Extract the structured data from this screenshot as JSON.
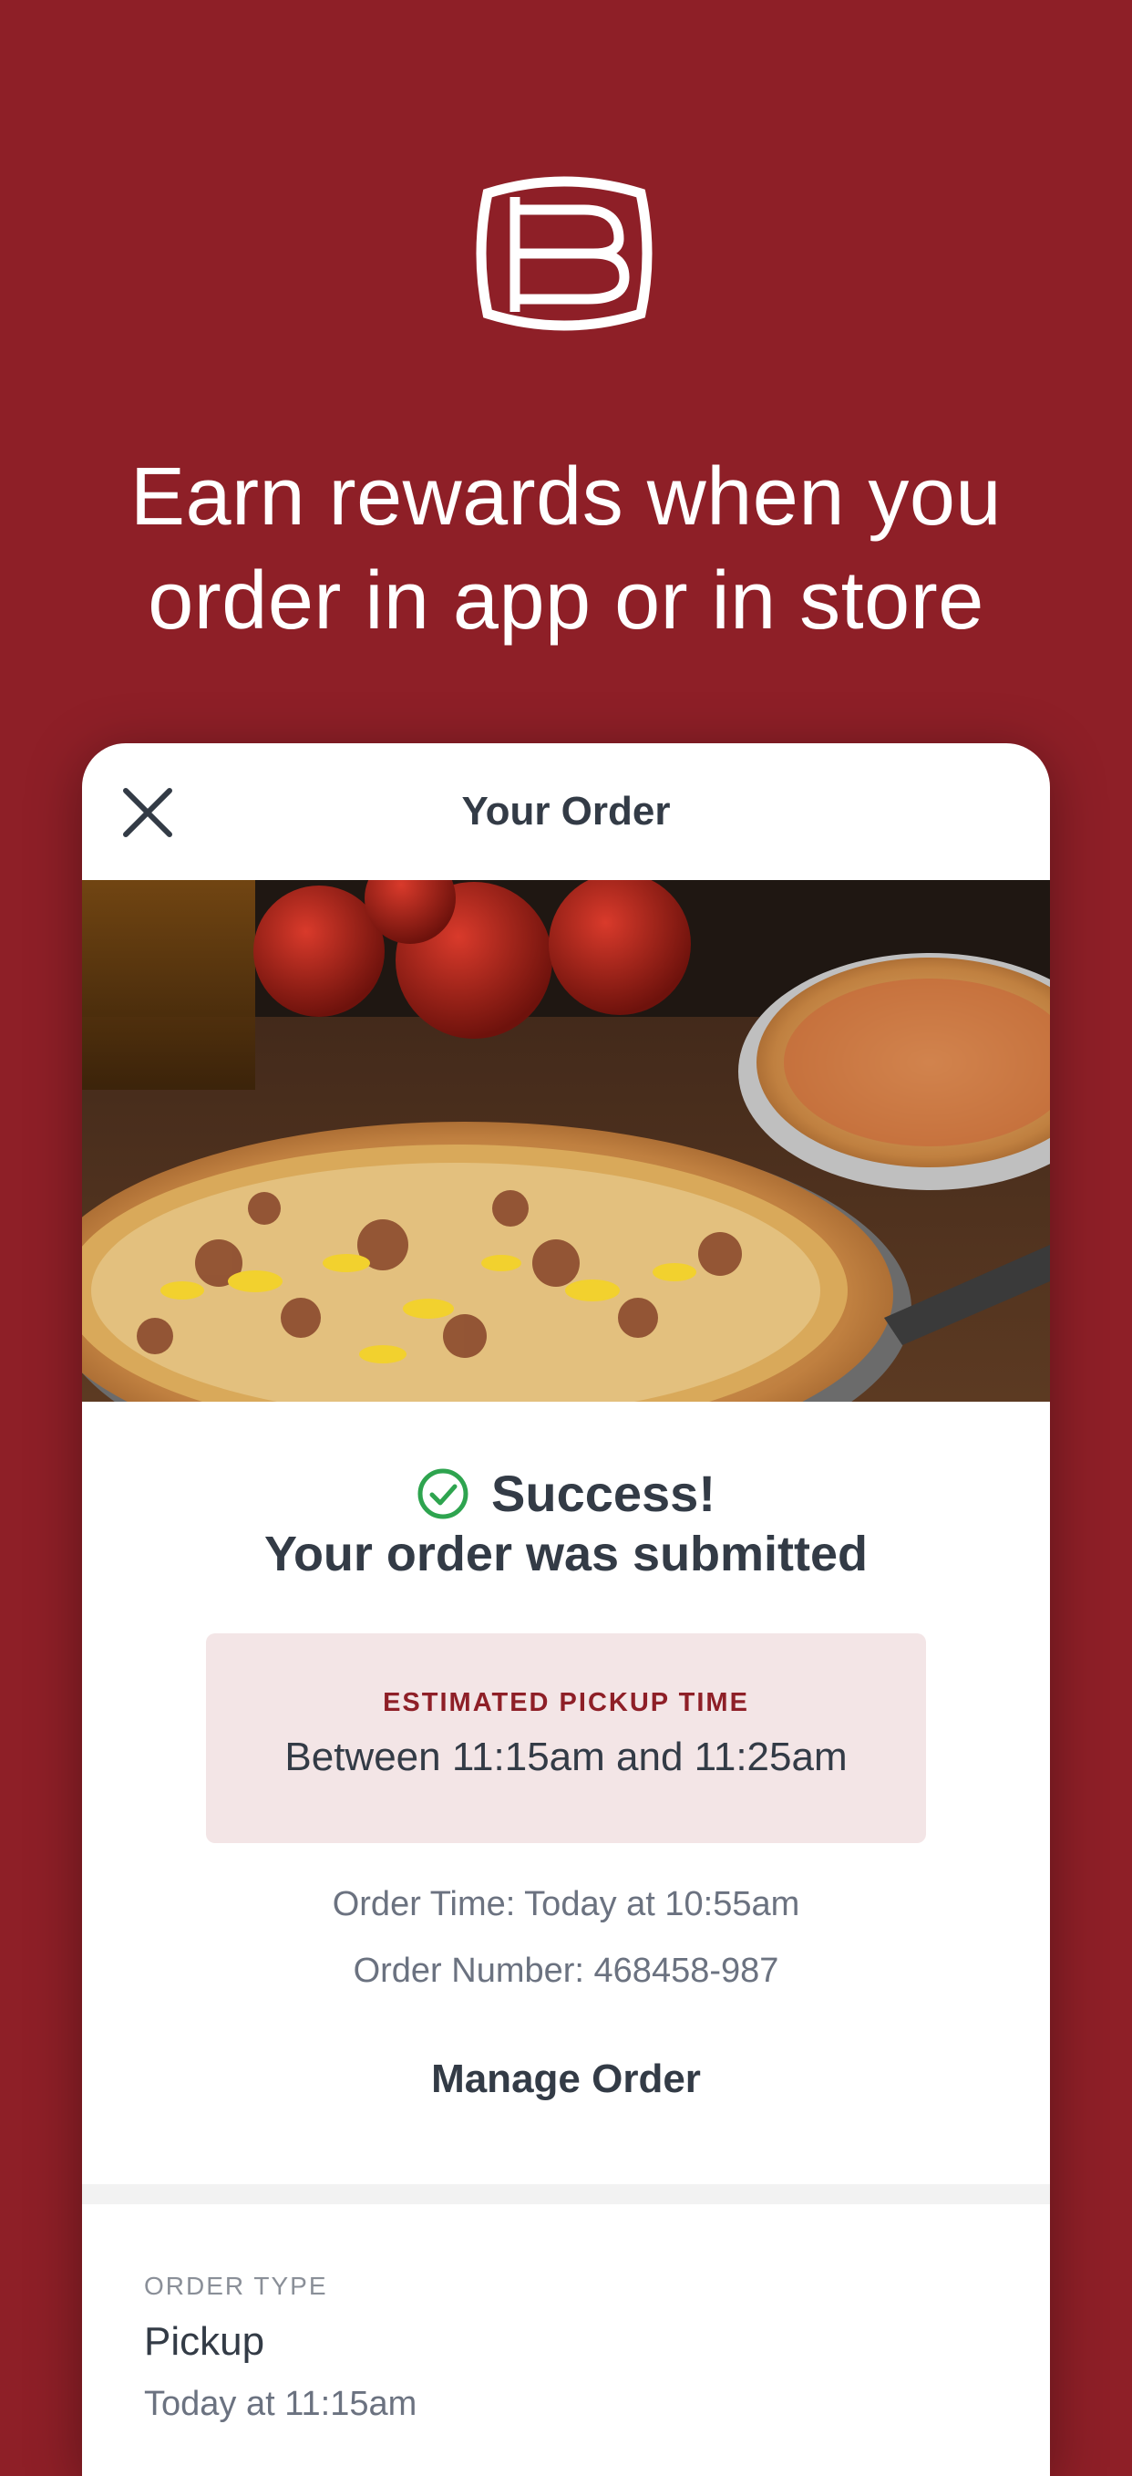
{
  "colors": {
    "brand_red": "#8e1f27",
    "text_dark": "#333b46",
    "success_green": "#2ea44f",
    "pickup_box_bg": "#f3e5e6"
  },
  "promo": {
    "headline_line1": "Earn rewards when you",
    "headline_line2": "order in app or in store"
  },
  "card": {
    "title": "Your Order",
    "close_icon": "close-icon"
  },
  "confirmation": {
    "success_title": "Success!",
    "success_icon": "check-circle-icon",
    "subtitle": "Your order was submitted"
  },
  "pickup": {
    "label": "ESTIMATED PICKUP TIME",
    "time": "Between 11:15am and 11:25am"
  },
  "order": {
    "time": "Order Time: Today at 10:55am",
    "number": "Order Number: 468458-987",
    "manage_label": "Manage Order"
  },
  "order_type": {
    "label": "ORDER TYPE",
    "value": "Pickup",
    "when": "Today at 11:15am"
  }
}
